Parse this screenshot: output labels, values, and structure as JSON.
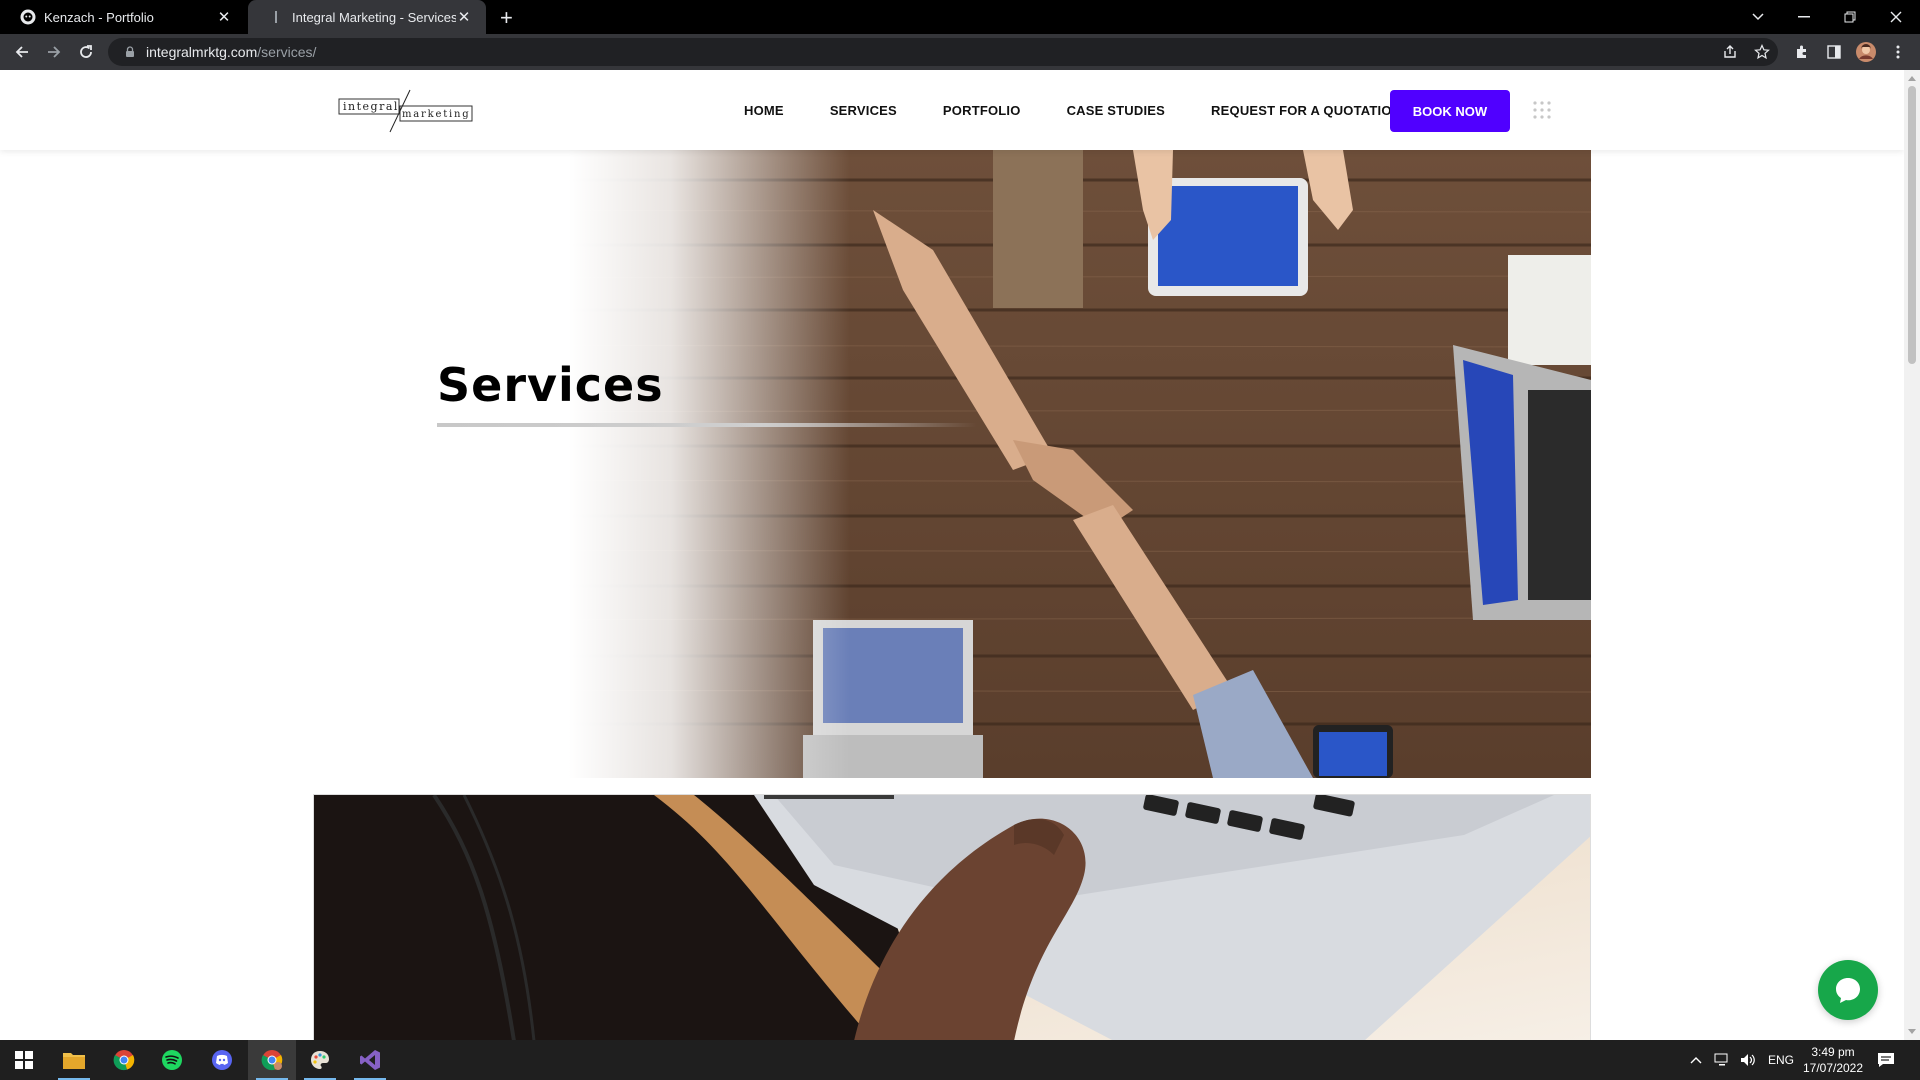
{
  "browser": {
    "tabs": [
      {
        "title": "Kenzach - Portfolio",
        "active": false
      },
      {
        "title": "Integral Marketing - Services - W",
        "active": true
      }
    ],
    "url_host": "integralmrktg.com",
    "url_path": "/services/"
  },
  "site": {
    "logo_text_top": "integral",
    "logo_text_bottom": "marketing",
    "nav": [
      "HOME",
      "SERVICES",
      "PORTFOLIO",
      "CASE STUDIES",
      "REQUEST FOR A QUOTATION"
    ],
    "book_now": "BOOK NOW",
    "accent_color": "#5000ff",
    "hero_title": "Services",
    "chat_color": "#17a74a"
  },
  "taskbar": {
    "apps": [
      "windows-start",
      "file-explorer",
      "chrome",
      "spotify",
      "discord",
      "chrome-profile",
      "paint",
      "visual-studio"
    ],
    "tray_lang": "ENG",
    "time": "3:49 pm",
    "date": "17/07/2022"
  }
}
